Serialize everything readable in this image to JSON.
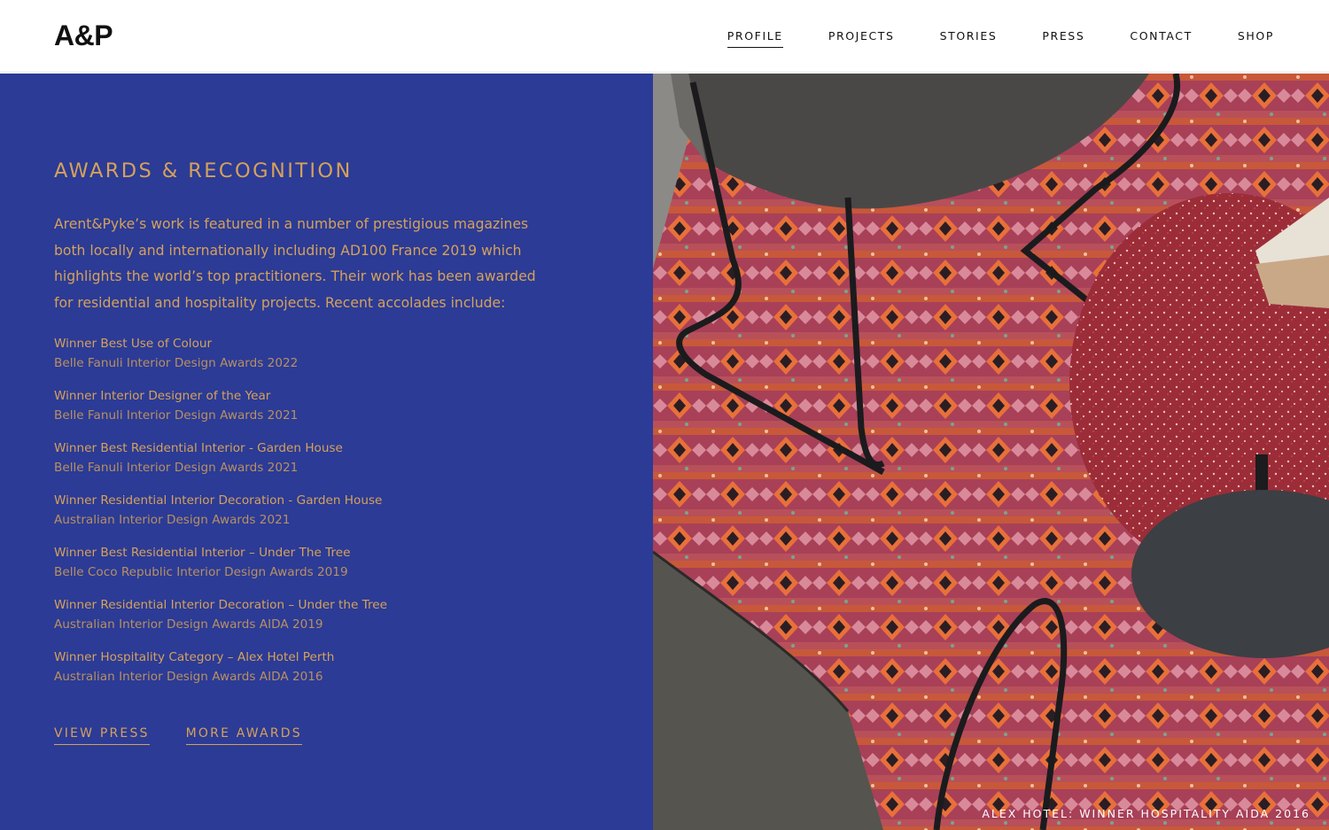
{
  "header": {
    "logo": "A&P",
    "nav": [
      {
        "label": "PROFILE",
        "active": true
      },
      {
        "label": "PROJECTS",
        "active": false
      },
      {
        "label": "STORIES",
        "active": false
      },
      {
        "label": "PRESS",
        "active": false
      },
      {
        "label": "CONTACT",
        "active": false
      },
      {
        "label": "SHOP",
        "active": false
      }
    ]
  },
  "main": {
    "title": "AWARDS & RECOGNITION",
    "intro": "Arent&Pyke’s work is featured in a number of prestigious magazines both locally and internationally including AD100 France 2019 which highlights the world’s top practitioners. Their work has been awarded for residential and hospitality projects. Recent accolades include:",
    "awards": [
      {
        "title": "Winner Best Use of Colour",
        "source": "Belle Fanuli Interior Design Awards 2022"
      },
      {
        "title": "Winner Interior Designer of the Year",
        "source": "Belle Fanuli Interior Design Awards 2021"
      },
      {
        "title": "Winner Best Residential Interior - Garden House",
        "source": "Belle Fanuli Interior Design Awards 2021"
      },
      {
        "title": "Winner Residential Interior Decoration - Garden House",
        "source": "Australian Interior Design Awards 2021"
      },
      {
        "title": "Winner Best Residential Interior – Under The Tree",
        "source": "Belle Coco Republic Interior Design Awards 2019"
      },
      {
        "title": "Winner Residential Interior Decoration – Under the Tree",
        "source": "Australian Interior Design Awards AIDA 2019"
      },
      {
        "title": "Winner Hospitality Category – Alex Hotel Perth",
        "source": "Australian Interior Design Awards AIDA 2016"
      }
    ],
    "links": {
      "view_press": "VIEW PRESS",
      "more_awards": "MORE AWARDS"
    }
  },
  "photo": {
    "caption": "ALEX HOTEL: WINNER HOSPITALITY AIDA 2016"
  },
  "colors": {
    "panel_bg": "#2b3b96",
    "accent_gold": "#d6a15a",
    "header_bg": "#ffffff",
    "text_dark": "#111111"
  }
}
